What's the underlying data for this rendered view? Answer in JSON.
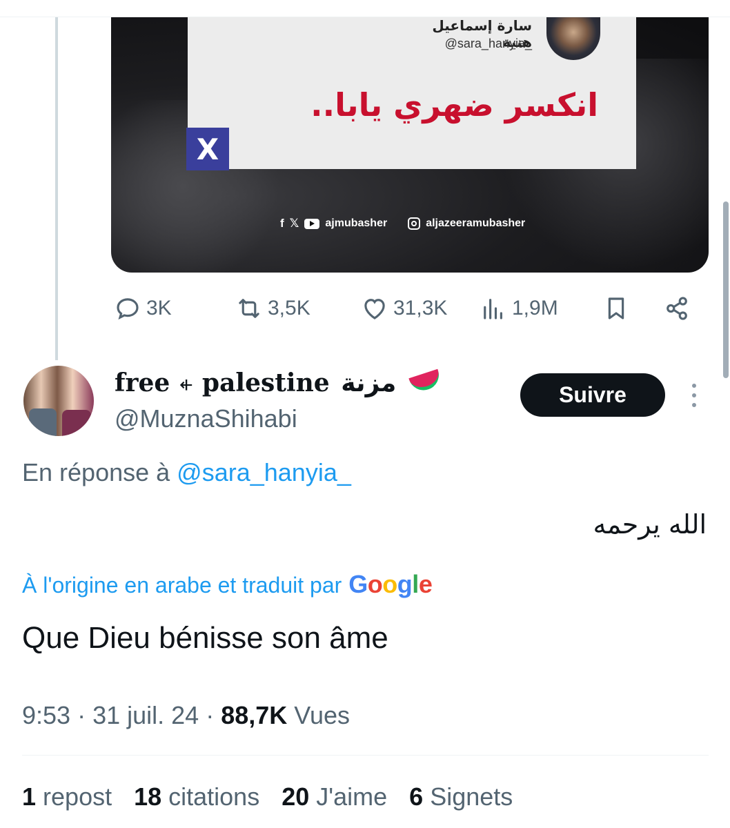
{
  "media": {
    "quoted_name": "سارة إسماعيل هنية",
    "quoted_handle": "@sara_hanyia_",
    "headline": "انكسر ضهري يابا..",
    "x_badge": "X",
    "social_handle_1": "ajmubasher",
    "social_handle_2": "aljazeeramubasher"
  },
  "actions": {
    "replies": "3K",
    "reposts": "3,5K",
    "likes": "31,3K",
    "views": "1,9M"
  },
  "author": {
    "display_name_latin": "free ⍅ palestine",
    "display_name_arabic": "مزنة",
    "handle": "@MuznaShihabi",
    "follow_label": "Suivre"
  },
  "reply": {
    "prefix": "En réponse à ",
    "mention": "@sara_hanyia_"
  },
  "tweet": {
    "original_text": "الله يرحمه",
    "translated_by": "À l'origine en arabe et traduit par",
    "translation_provider": [
      "G",
      "o",
      "o",
      "g",
      "l",
      "e"
    ],
    "translation": "Que Dieu bénisse son âme"
  },
  "meta": {
    "time": "9:53",
    "separator": " · ",
    "date": "31 juil. 24",
    "views_count": "88,7K",
    "views_label": " Vues"
  },
  "stats": [
    {
      "count": "1",
      "label": " repost"
    },
    {
      "count": "18",
      "label": " citations"
    },
    {
      "count": "20",
      "label": " J'aime"
    },
    {
      "count": "6",
      "label": " Signets"
    }
  ],
  "colors": {
    "accent": "#1d9bf0",
    "text_primary": "#0f1419",
    "text_secondary": "#536471",
    "headline_red": "#c8102e"
  }
}
